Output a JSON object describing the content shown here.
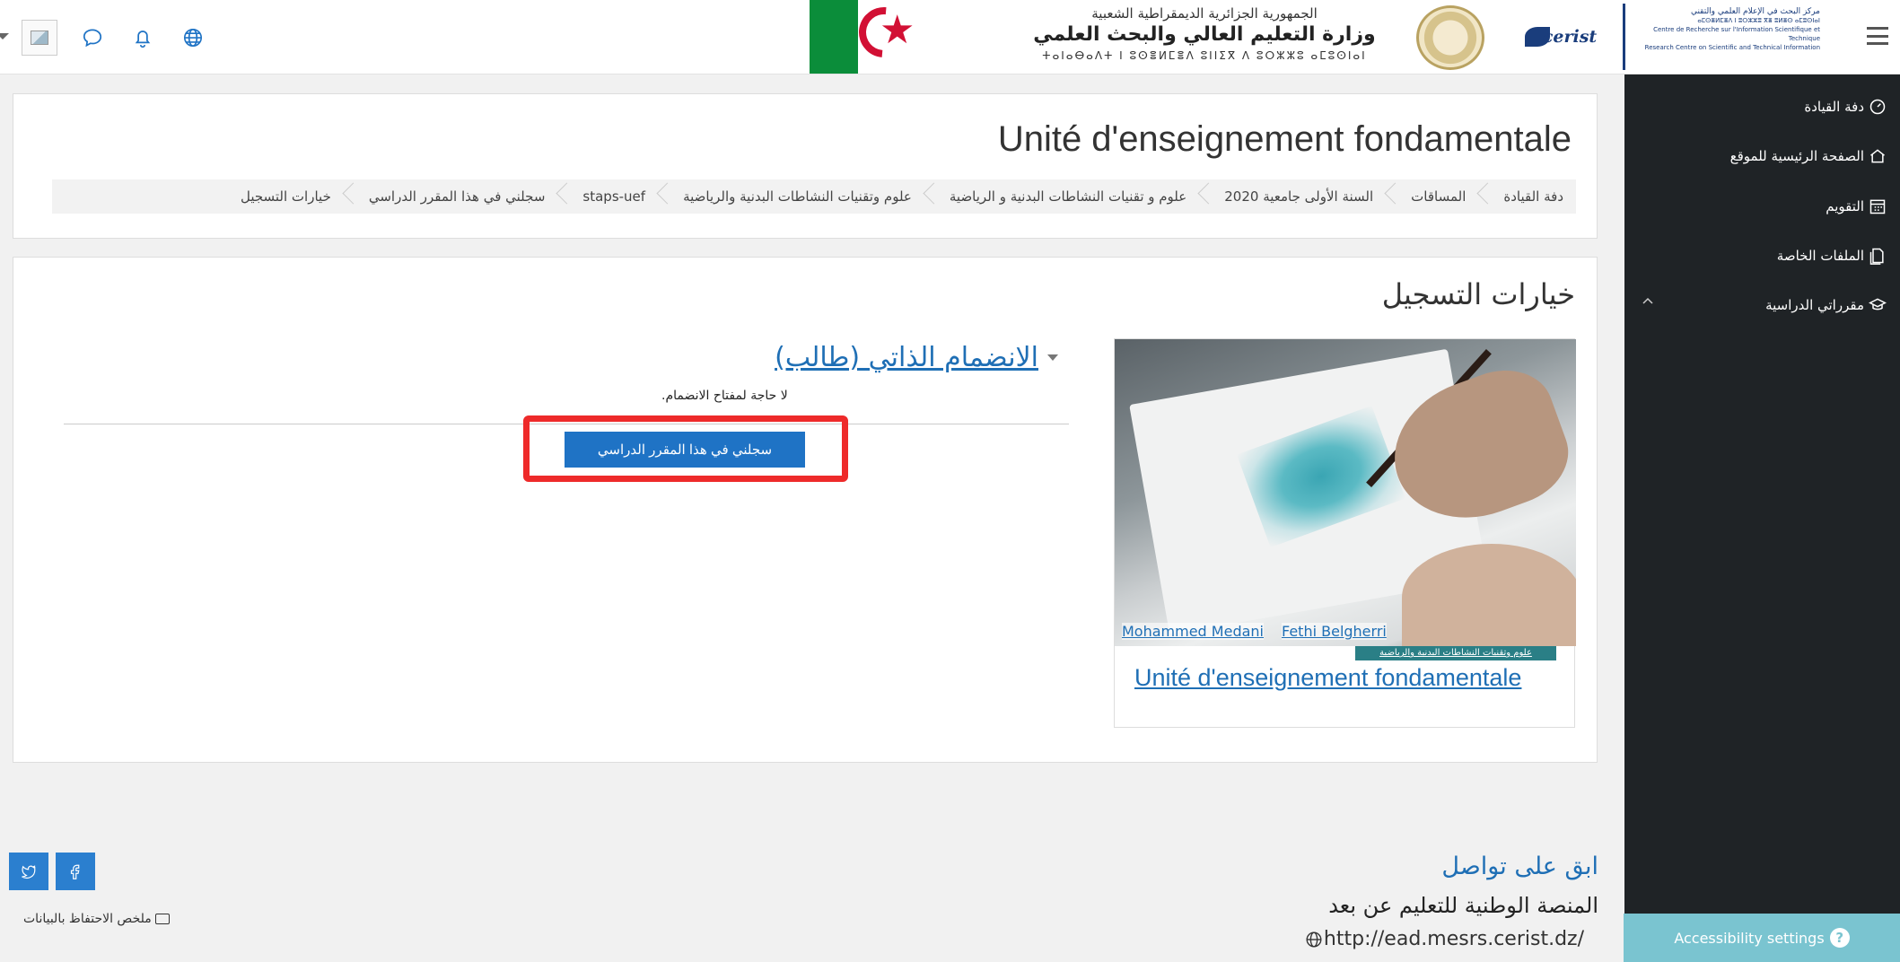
{
  "header": {
    "gov_line1": "الجمهورية الجزائرية الديمقراطية الشعبية",
    "gov_line2": "وزارة التعليم العالي والبحث العلمي",
    "gov_line3": "ⵜⴰⵏⴰⴱⴰⴷⵜ ⵏ ⵓⵙⴻⵍⵎⴻⴷ ⵓⵏⵏⵉⴳ ⴷ ⵓⵔⵣⵣⵓ ⴰⵎⵓⵙⵏⴰⵏ",
    "cerist_mark": "cerist",
    "cerist_ar": "مركز البحث في الإعلام العلمي والتقني",
    "cerist_tif": "ⴰⵎⵙⴻⵍⵎⴻⴷ ⵏ ⵓⵔⵣⵣⵓ ⴳⴻ ⵓⵍⴻⵙ ⴰⵎⵓⵙⵏⴰⵏ",
    "cerist_fr": "Centre de Recherche sur l'Information Scientifique et Technique",
    "cerist_en": "Research Centre on Scientific and Technical Information"
  },
  "sidebar": {
    "items": [
      {
        "label": "دفة القيادة",
        "icon": "dashboard-icon"
      },
      {
        "label": "الصفحة الرئيسية للموقع",
        "icon": "home-icon"
      },
      {
        "label": "التقويم",
        "icon": "calendar-icon"
      },
      {
        "label": "الملفات الخاصة",
        "icon": "files-icon"
      },
      {
        "label": "مقرراتي الدراسية",
        "icon": "graduation-cap-icon"
      }
    ]
  },
  "accessibility": {
    "label": "Accessibility settings"
  },
  "course_header": {
    "title": "Unité d'enseignement fondamentale",
    "breadcrumb": [
      "دفة القيادة",
      "المساقات",
      "السنة الأولى جامعية 2020",
      "علوم و تقنيات النشاطات البدنية و الرياضية",
      "علوم وتقنيات النشاطات البدنية والرياضية",
      "staps-uef",
      "سجلني في هذا المقرر الدراسي",
      "خيارات التسجيل"
    ]
  },
  "enrol": {
    "section_title": "خيارات التسجيل",
    "method_title": "الانضمام الذاتي (طالب)",
    "no_key_text": "لا حاجة لمفتاح الانضمام.",
    "button_label": "سجلني في هذا المقرر الدراسي"
  },
  "course_tile": {
    "teachers": [
      "Mohammed Medani",
      "Fethi Belgherri"
    ],
    "category": "علوم وتقنيات النشاطات البدنية والرياضية",
    "name": "Unité d'enseignement fondamentale"
  },
  "footer": {
    "title": "ابق على تواصل",
    "subtitle": "المنصة الوطنية للتعليم عن بعد",
    "url": "http://ead.mesrs.cerist.dz/",
    "data_summary": "ملخص الاحتفاظ بالبيانات"
  }
}
